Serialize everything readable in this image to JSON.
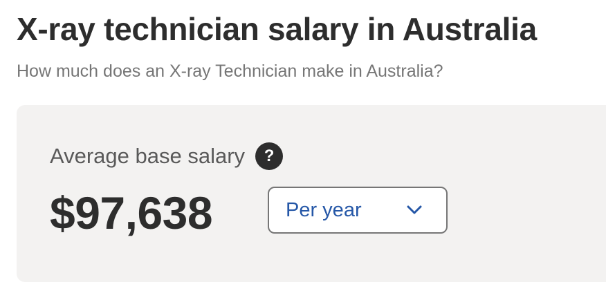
{
  "header": {
    "title": "X-ray technician salary in Australia",
    "subtitle": "How much does an X-ray Technician make in Australia?"
  },
  "salary_card": {
    "label": "Average base salary",
    "help_icon_glyph": "?",
    "amount": "$97,638",
    "period_select": {
      "selected": "Per year"
    }
  },
  "colors": {
    "text_primary": "#2d2d2d",
    "text_secondary": "#767676",
    "card_background": "#f3f2f1",
    "link_blue": "#2557a7"
  },
  "icons": {
    "help": "question-circle-icon",
    "dropdown": "chevron-down-icon"
  }
}
